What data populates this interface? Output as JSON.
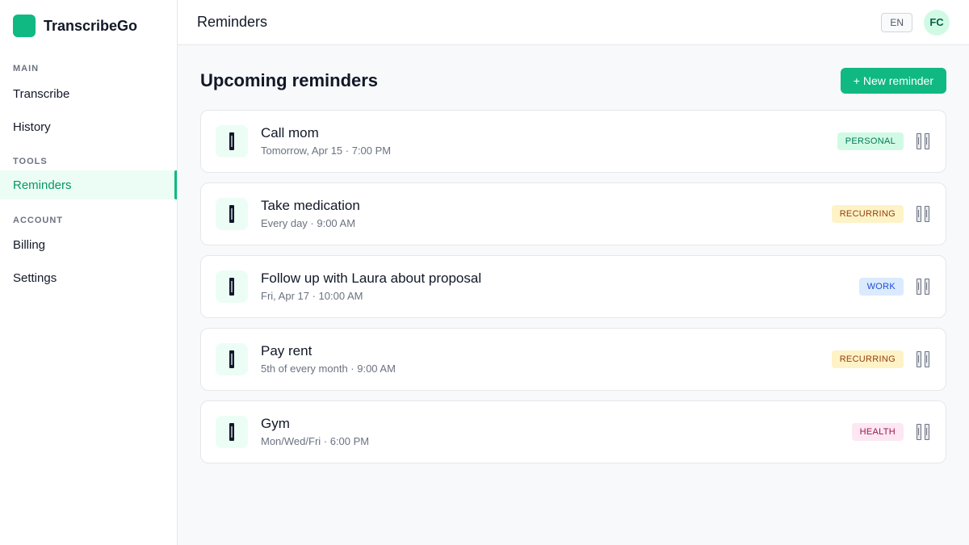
{
  "app": {
    "name": "TranscribeGo",
    "brand_color": "#10b981"
  },
  "sidebar": {
    "sections": [
      {
        "label": "MAIN",
        "items": [
          {
            "label": "Transcribe",
            "active": false
          },
          {
            "label": "History",
            "active": false
          }
        ]
      },
      {
        "label": "TOOLS",
        "items": [
          {
            "label": "Reminders",
            "active": true
          }
        ]
      },
      {
        "label": "ACCOUNT",
        "items": [
          {
            "label": "Billing",
            "active": false
          },
          {
            "label": "Settings",
            "active": false
          }
        ]
      }
    ]
  },
  "header": {
    "title": "Reminders",
    "language": "EN",
    "avatar_initials": "FC"
  },
  "main": {
    "heading": "Upcoming reminders",
    "new_button_label": "+ New reminder",
    "reminders": [
      {
        "title": "Call mom",
        "schedule": "Tomorrow, Apr 15 · 7:00 PM",
        "tag": "PERSONAL",
        "tag_style": "personal",
        "icon": "bell-icon"
      },
      {
        "title": "Take medication",
        "schedule": "Every day · 9:00 AM",
        "tag": "RECURRING",
        "tag_style": "recurring",
        "icon": "bell-icon"
      },
      {
        "title": "Follow up with Laura about proposal",
        "schedule": "Fri, Apr 17 · 10:00 AM",
        "tag": "WORK",
        "tag_style": "work",
        "icon": "bell-icon"
      },
      {
        "title": "Pay rent",
        "schedule": "5th of every month · 9:00 AM",
        "tag": "RECURRING",
        "tag_style": "recurring",
        "icon": "bell-icon"
      },
      {
        "title": "Gym",
        "schedule": "Mon/Wed/Fri · 6:00 PM",
        "tag": "HEALTH",
        "tag_style": "health",
        "icon": "bell-icon"
      }
    ]
  }
}
